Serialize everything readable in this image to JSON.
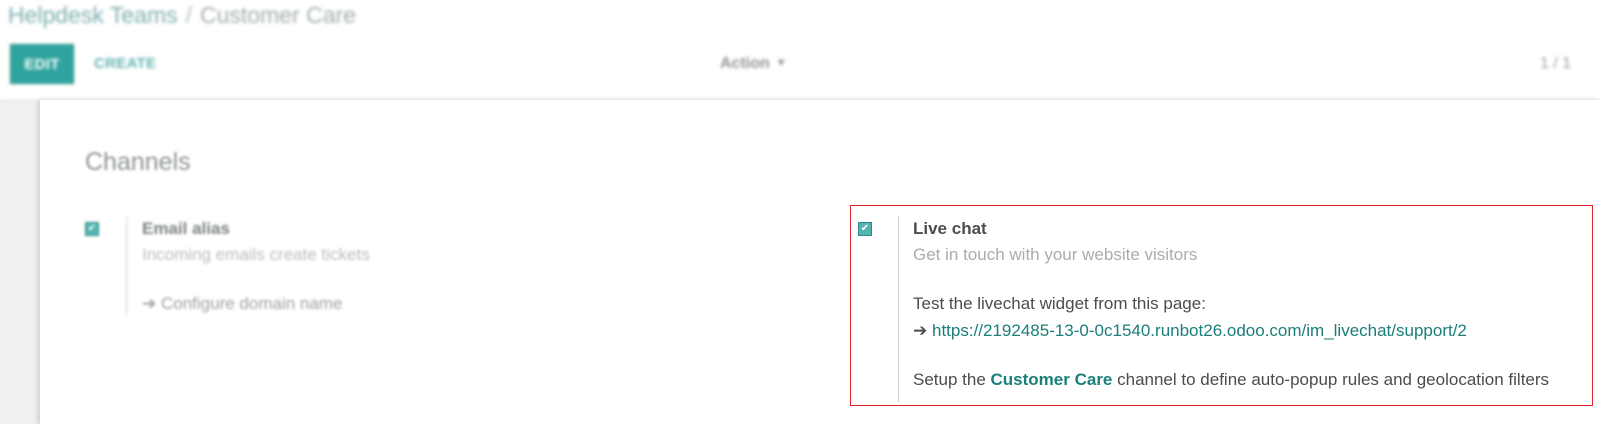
{
  "breadcrumb": {
    "parent": "Helpdesk Teams",
    "separator": "/",
    "current": "Customer Care"
  },
  "toolbar": {
    "edit_label": "EDIT",
    "create_label": "CREATE",
    "action_label": "Action",
    "pager": "1 / 1"
  },
  "section": {
    "title": "Channels"
  },
  "email_alias": {
    "checked": true,
    "title": "Email alias",
    "description": "Incoming emails create tickets",
    "configure_label": "Configure domain name",
    "configure_icon": "arrow-right-icon"
  },
  "live_chat": {
    "checked": true,
    "title": "Live chat",
    "description": "Get in touch with your website visitors",
    "test_text": "Test the livechat widget from this page:",
    "url_icon": "arrow-right-icon",
    "url": "https://2192485-13-0-0c1540.runbot26.odoo.com/im_livechat/support/2",
    "setup_prefix": "Setup the ",
    "setup_link": "Customer Care",
    "setup_suffix": " channel to define auto-popup rules and geolocation filters"
  },
  "colors": {
    "accent": "#2fa49e",
    "link": "#1a7f7a",
    "highlight": "#e0242c"
  }
}
